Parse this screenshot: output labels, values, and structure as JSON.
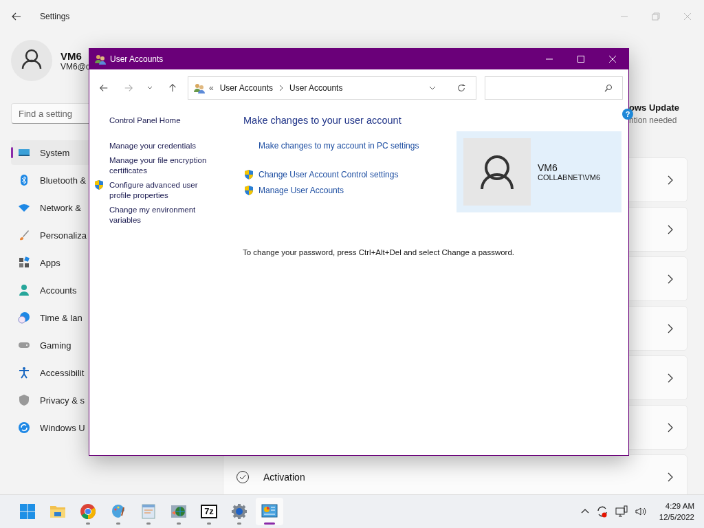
{
  "settings": {
    "title": "Settings",
    "profile": {
      "name": "VM6",
      "email": "VM6@c"
    },
    "search": {
      "placeholder": "Find a setting"
    },
    "nav": [
      {
        "label": "System",
        "selected": true
      },
      {
        "label": "Bluetooth &",
        "selected": false
      },
      {
        "label": "Network &",
        "selected": false
      },
      {
        "label": "Personaliza",
        "selected": false
      },
      {
        "label": "Apps",
        "selected": false
      },
      {
        "label": "Accounts",
        "selected": false
      },
      {
        "label": "Time & lan",
        "selected": false
      },
      {
        "label": "Gaming",
        "selected": false
      },
      {
        "label": "Accessibilit",
        "selected": false
      },
      {
        "label": "Privacy & s",
        "selected": false
      },
      {
        "label": "Windows U",
        "selected": false
      }
    ],
    "update": {
      "title": "ows Update",
      "status": "ntion needed"
    },
    "cards": [
      {
        "kind": "blank"
      },
      {
        "kind": "blank"
      },
      {
        "kind": "blank"
      },
      {
        "kind": "blank"
      },
      {
        "kind": "blank"
      },
      {
        "kind": "blank"
      },
      {
        "kind": "activation",
        "title": "Activation"
      }
    ]
  },
  "dialog": {
    "title": "User Accounts",
    "breadcrumb": [
      "User Accounts",
      "User Accounts"
    ],
    "breadcrumb_prefix": "«",
    "left_links": [
      {
        "label": "Control Panel Home",
        "shield": false
      },
      {
        "label": "Manage your credentials",
        "shield": false
      },
      {
        "label": "Manage your file encryption certificates",
        "shield": false
      },
      {
        "label": "Configure advanced user profile properties",
        "shield": true
      },
      {
        "label": "Change my environment variables",
        "shield": false
      }
    ],
    "heading": "Make changes to your user account",
    "links": [
      {
        "label": "Make changes to my account in PC settings",
        "shield": false
      },
      {
        "label": "Change User Account Control settings",
        "shield": true
      },
      {
        "label": "Manage User Accounts",
        "shield": true
      }
    ],
    "user": {
      "name": "VM6",
      "account": "COLLABNET\\VM6"
    },
    "note": "To change your password, press Ctrl+Alt+Del and select Change a password.",
    "help": "?"
  },
  "taskbar": {
    "apps": [
      {
        "running": false,
        "selected": false
      },
      {
        "running": false,
        "selected": false
      },
      {
        "running": true,
        "selected": false
      },
      {
        "running": true,
        "selected": false
      },
      {
        "running": true,
        "selected": false
      },
      {
        "running": true,
        "selected": false
      },
      {
        "label": "7z",
        "running": true,
        "selected": false
      },
      {
        "running": true,
        "selected": false
      },
      {
        "running": true,
        "selected": true
      }
    ],
    "time": "4:29 AM",
    "date": "12/5/2022"
  }
}
